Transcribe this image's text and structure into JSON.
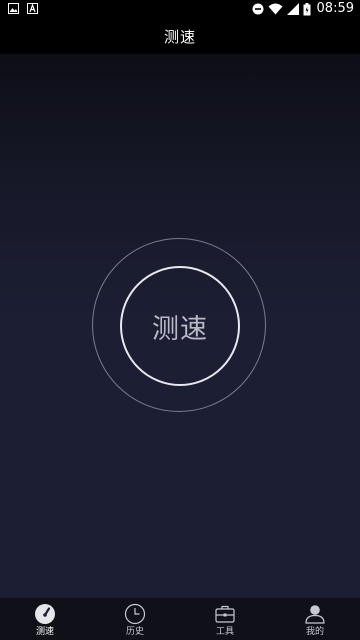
{
  "status_bar": {
    "time": "08:59",
    "left_icons": [
      "image-icon",
      "font-a-icon"
    ],
    "right_icons": [
      "do-not-disturb-icon",
      "wifi-icon",
      "signal-icon",
      "battery-icon"
    ]
  },
  "header": {
    "title": "测速"
  },
  "main": {
    "speed_button_label": "测速"
  },
  "tabs": [
    {
      "label": "测速",
      "icon": "speedometer-icon",
      "active": true
    },
    {
      "label": "历史",
      "icon": "clock-icon",
      "active": false
    },
    {
      "label": "工具",
      "icon": "toolbox-icon",
      "active": false
    },
    {
      "label": "我的",
      "icon": "user-icon",
      "active": false
    }
  ],
  "colors": {
    "background": "#1c1e34",
    "header": "#000000",
    "tab_bar": "#0f1018",
    "outer_ring": "#7a7c8e",
    "inner_ring": "#e8e8ee"
  }
}
